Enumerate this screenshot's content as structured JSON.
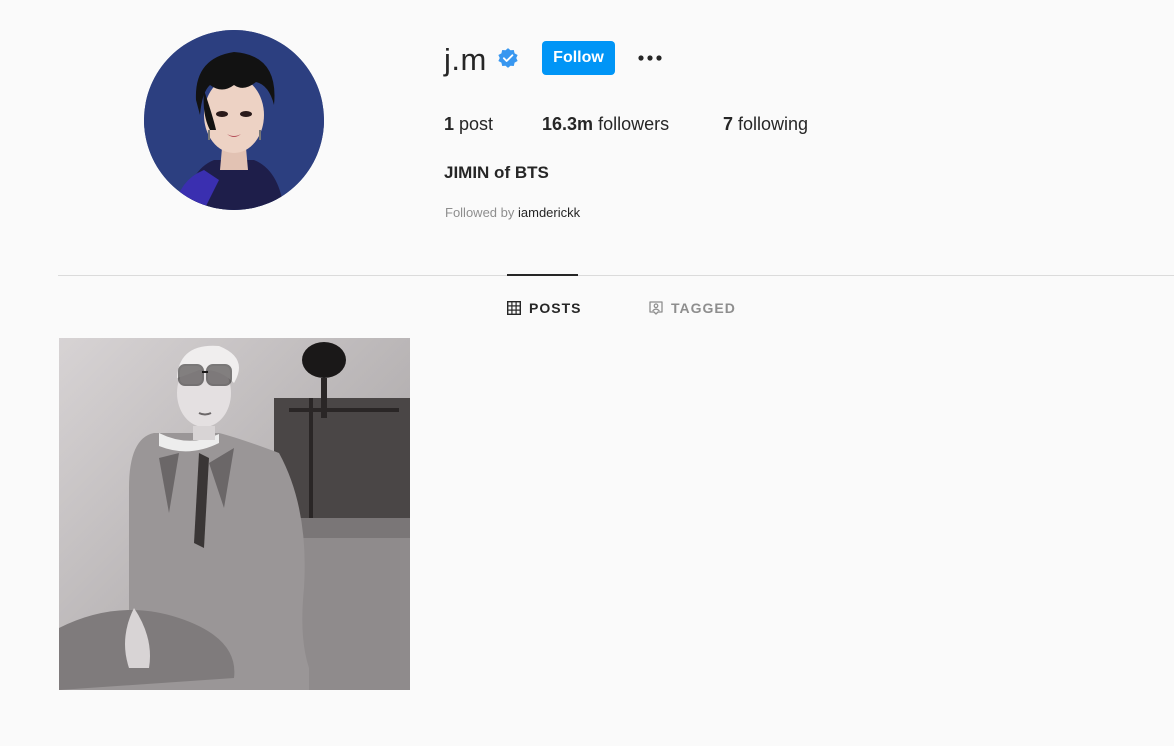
{
  "profile": {
    "username": "j.m",
    "follow_label": "Follow",
    "stats": {
      "posts_count": "1",
      "posts_label": "post",
      "followers_count": "16.3m",
      "followers_label": "followers",
      "following_count": "7",
      "following_label": "following"
    },
    "bio_name": "JIMIN of BTS",
    "followed_by_prefix": "Followed by",
    "followed_by_user": "iamderickk"
  },
  "tabs": [
    {
      "label": "POSTS",
      "icon": "grid-icon",
      "active": true
    },
    {
      "label": "TAGGED",
      "icon": "tagged-icon",
      "active": false
    }
  ],
  "icons": {
    "verified": "verified-badge-icon",
    "more": "more-options-icon"
  },
  "colors": {
    "accent": "#0095f6",
    "text": "#262626",
    "muted": "#8e8e8e",
    "divider": "#dbdbdb",
    "background": "#fafafa"
  }
}
